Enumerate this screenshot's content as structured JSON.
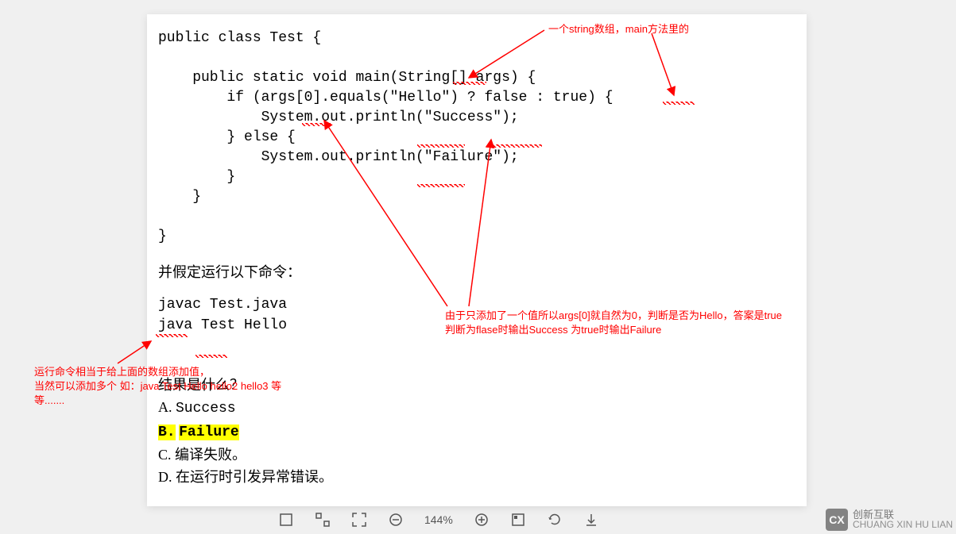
{
  "code": {
    "lines": "public class Test {\n\n    public static void main(String[] args) {\n        if (args[0].equals(\"Hello\") ? false : true) {\n            System.out.println(\"Success\");\n        } else {\n            System.out.println(\"Failure\");\n        }\n    }\n\n}"
  },
  "assume_text": "并假定运行以下命令：",
  "commands": "javac Test.java\njava Test Hello",
  "question": "结果是什么？",
  "options": {
    "a_label": "A.",
    "a_text": "Success",
    "b_label": "B.",
    "b_text": "Failure",
    "c_label": "C.",
    "c_text": "编译失败。",
    "d_label": "D.",
    "d_text": "在运行时引发异常错误。"
  },
  "annotations": {
    "top": "一个string数组，main方法里的",
    "right_line1": "由于只添加了一个值所以args[0]就自然为0，判断是否为Hello，答案是true",
    "right_line2": "判断为flase时输出Success 为true时输出Failure",
    "left_line1": "运行命令相当于给上面的数组添加值，",
    "left_line2": "当然可以添加多个 如：java Test Hello hello2 hello3 等等......."
  },
  "toolbar": {
    "zoom": "144%"
  },
  "watermark": {
    "logo": "CX",
    "line1": "创新互联",
    "line2": "CHUANG XIN HU LIAN"
  }
}
